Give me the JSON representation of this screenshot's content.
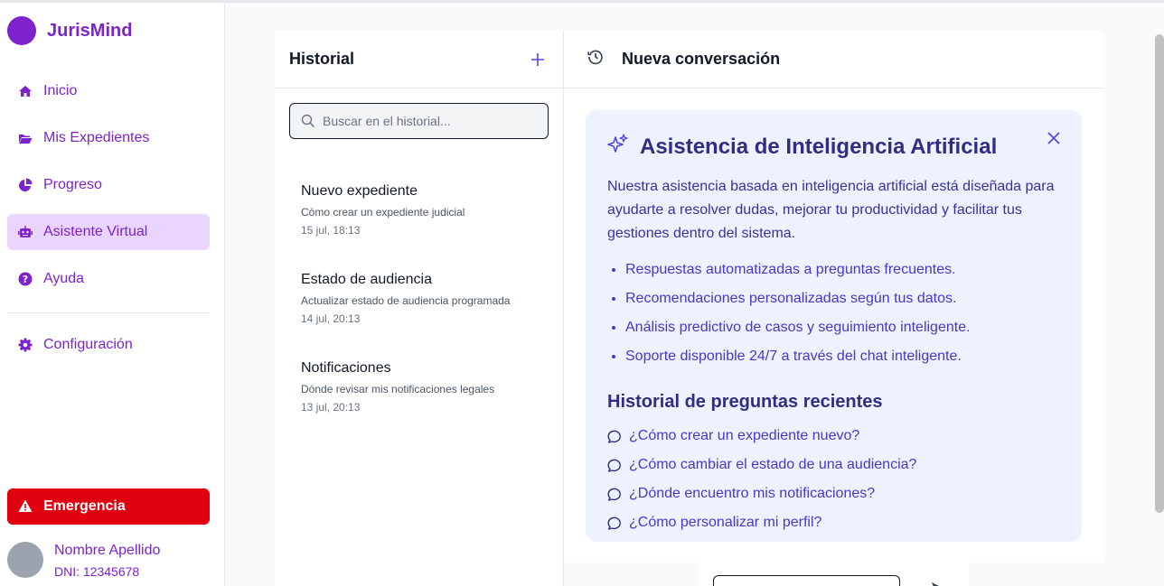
{
  "brand": {
    "name": "JurisMind"
  },
  "nav": {
    "items": [
      {
        "label": "Inicio",
        "icon": "home-icon"
      },
      {
        "label": "Mis Expedientes",
        "icon": "folder-open-icon"
      },
      {
        "label": "Progreso",
        "icon": "pie-chart-icon"
      },
      {
        "label": "Asistente Virtual",
        "icon": "robot-icon",
        "active": true
      },
      {
        "label": "Ayuda",
        "icon": "question-circle-icon"
      }
    ],
    "settings": {
      "label": "Configuración",
      "icon": "gear-icon"
    }
  },
  "emergency": {
    "label": "Emergencia"
  },
  "user": {
    "name": "Nombre Apellido",
    "dni": "DNI: 12345678"
  },
  "history": {
    "title": "Historial",
    "search_placeholder": "Buscar en el historial...",
    "items": [
      {
        "title": "Nuevo expediente",
        "subtitle": "Cómo crear un expediente judicial",
        "date": "15 jul, 18:13"
      },
      {
        "title": "Estado de audiencia",
        "subtitle": "Actualizar estado de audiencia programada",
        "date": "14 jul, 20:13"
      },
      {
        "title": "Notificaciones",
        "subtitle": "Dónde revisar mis notificaciones legales",
        "date": "13 jul, 20:13"
      }
    ]
  },
  "chat": {
    "title": "Nueva conversación",
    "ai_card": {
      "title": "Asistencia de Inteligencia Artificial",
      "description": "Nuestra asistencia basada en inteligencia artificial está diseñada para ayudarte a resolver dudas, mejorar tu productividad y facilitar tus gestiones dentro del sistema.",
      "features": [
        "Respuestas automatizadas a preguntas frecuentes.",
        "Recomendaciones personalizadas según tus datos.",
        "Análisis predictivo de casos y seguimiento inteligente.",
        "Soporte disponible 24/7 a través del chat inteligente."
      ],
      "recent_title": "Historial de preguntas recientes",
      "recent_questions": [
        "¿Cómo crear un expediente nuevo?",
        "¿Cómo cambiar el estado de una audiencia?",
        "¿Dónde encuentro mis notificaciones?",
        "¿Cómo personalizar mi perfil?"
      ]
    }
  },
  "colors": {
    "brand": "#7e22ce",
    "active_bg": "#e9d5ff",
    "emergency": "#e00010",
    "card_bg": "#eef2ff",
    "accent": "#4338ca"
  }
}
